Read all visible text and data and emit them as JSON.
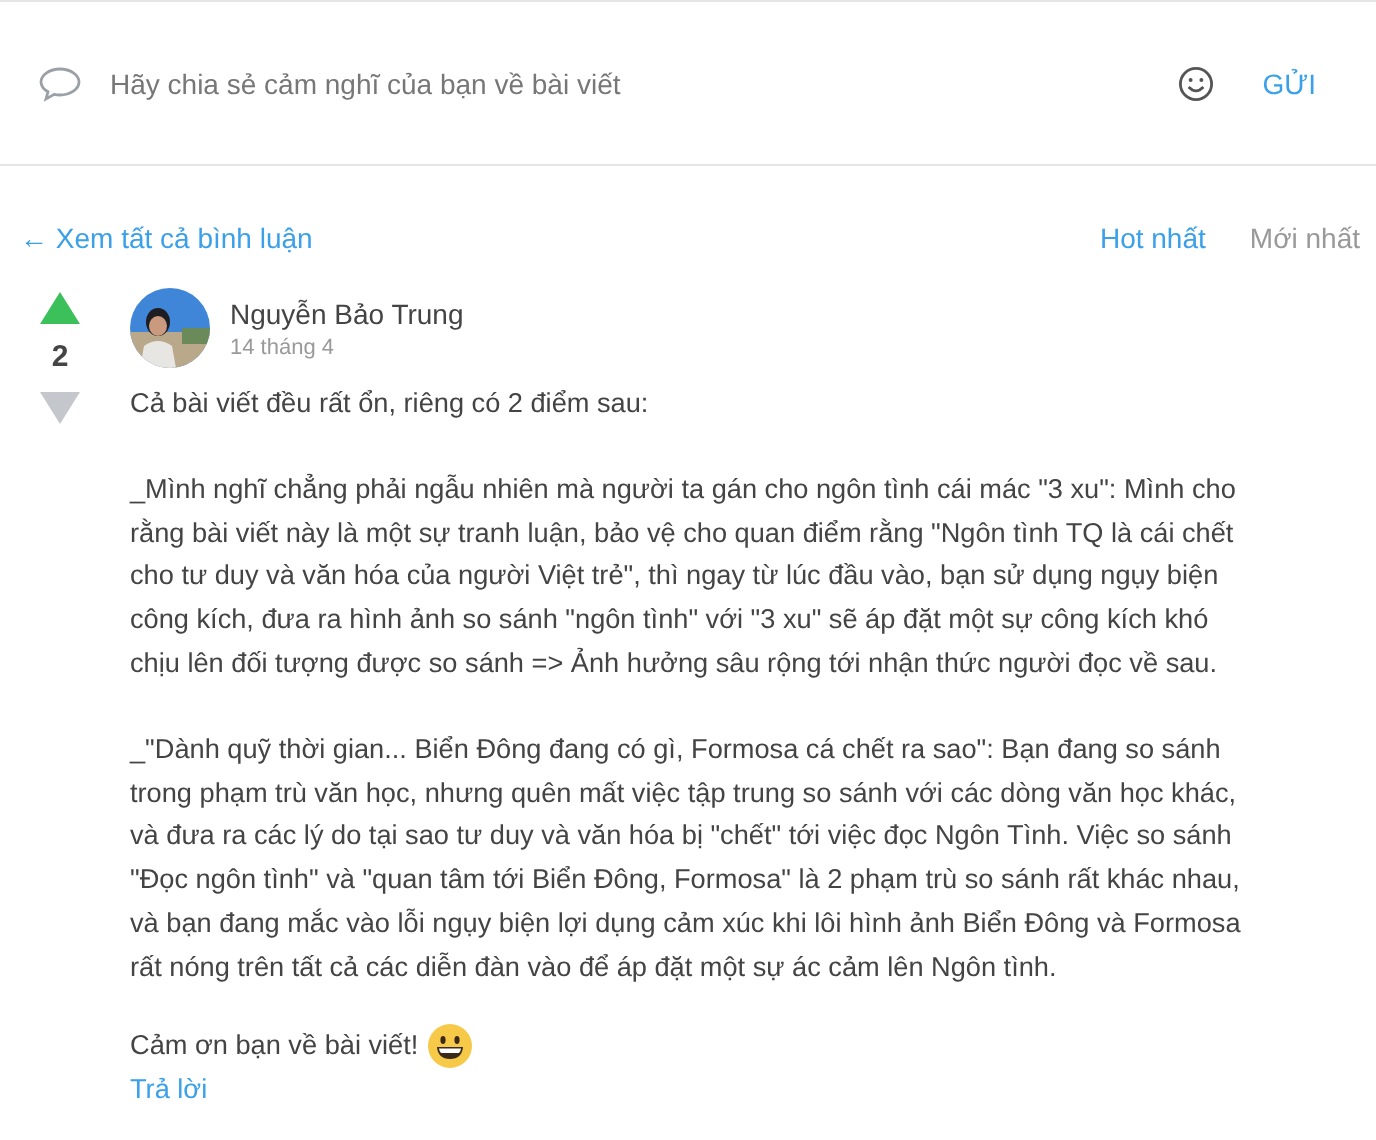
{
  "composer": {
    "placeholder": "Hãy chia sẻ cảm nghĩ của bạn về bài viết",
    "send": "GỬI"
  },
  "toolbar": {
    "back_link": "← Xem tất cả bình luận",
    "sort_tabs": [
      {
        "label": "Hot nhất",
        "selected": true
      },
      {
        "label": "Mới nhất",
        "selected": false
      }
    ]
  },
  "comment": {
    "votes": "2",
    "upvoted": true,
    "downvoted": false,
    "avatar": {
      "kind": "picture"
    },
    "author": "Nguyễn Bảo Trung",
    "date": "14 tháng 4",
    "paragraphs": [
      [
        "Cả bài viết đều rất ổn, riêng có 2 điểm sau:"
      ],
      [
        "_Mình nghĩ chẳng phải ngẫu nhiên mà người ta gán cho ngôn tình cái mác \"3 xu\": Mình cho",
        "rằng bài viết này là một sự tranh luận, bảo vệ cho quan điểm rằng \"Ngôn tình TQ là cái chết",
        "cho tư duy và văn hóa của người Việt trẻ\", thì ngay từ lúc đầu vào, bạn sử dụng ngụy biện",
        "công kích, đưa ra hình ảnh so sánh \"ngôn tình\" với \"3 xu\" sẽ áp đặt một sự công kích khó",
        "chịu lên đối tượng được so sánh => Ảnh hưởng sâu rộng tới nhận thức người đọc về sau."
      ],
      [
        "_\"Dành quỹ thời gian... Biển Đông đang có gì, Formosa cá chết ra sao\": Bạn đang so sánh",
        "trong phạm trù văn học, nhưng quên mất việc tập trung so sánh với các dòng văn học khác,",
        "và đưa ra các lý do tại sao tư duy và văn hóa bị \"chết\" tới việc đọc Ngôn Tình. Việc so sánh",
        "\"Đọc ngôn tình\" và \"quan tâm tới Biển Đông, Formosa\" là 2 phạm trù so sánh rất khác nhau,",
        "và bạn đang mắc vào lỗi ngụy biện lợi dụng cảm xúc khi lôi hình ảnh Biển Đông và Formosa",
        "rất nóng trên tất cả các diễn đàn vào để áp đặt một sự ác cảm lên Ngôn tình."
      ]
    ],
    "closing": "Cảm ơn bạn về bài viết!",
    "reply": "Trả lời"
  }
}
